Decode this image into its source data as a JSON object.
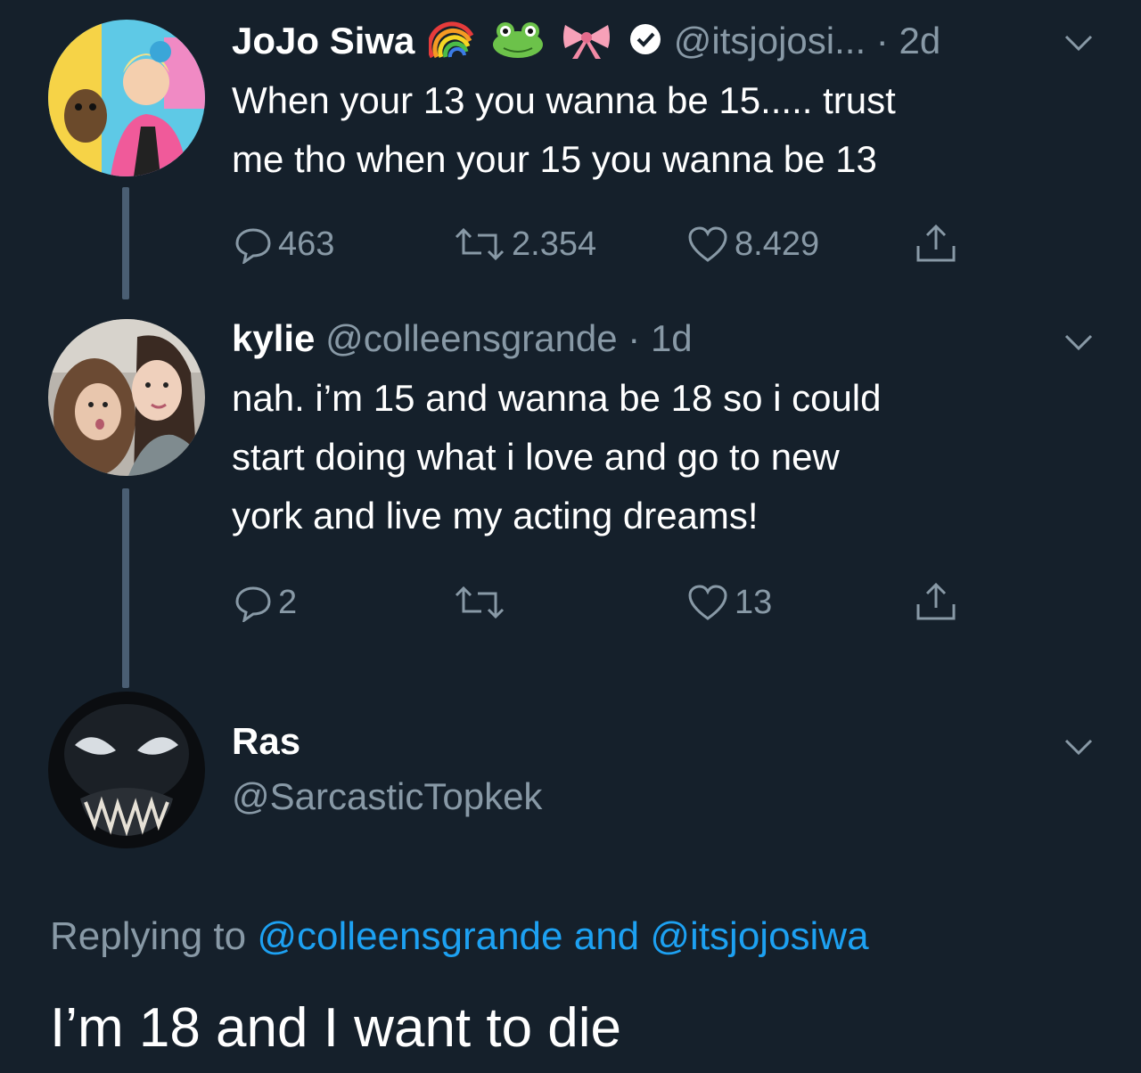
{
  "tweets": [
    {
      "name": "JoJo Siwa",
      "emojis": [
        "rainbow",
        "frog",
        "bow"
      ],
      "verified": true,
      "handle": "@itsjojosi...",
      "dot": "·",
      "time": "2d",
      "text": "When your 13 you wanna be 15..... trust\nme tho when your 15 you wanna be 13",
      "replies": "463",
      "retweets": "2.354",
      "likes": "8.429"
    },
    {
      "name": "kylie",
      "handle": "@colleensgrande",
      "dot": "·",
      "time": "1d",
      "text": "nah. i’m 15 and wanna be 18 so i could\nstart doing what i love and go to new\nyork and live my acting dreams!",
      "replies": "2",
      "retweets": "",
      "likes": "13"
    }
  ],
  "reply": {
    "name": "Ras",
    "handle": "@SarcasticTopkek",
    "replying_prefix": "Replying to",
    "mention1": "@colleensgrande",
    "and_word": "and",
    "mention2": "@itsjojosiwa",
    "text": "I’m 18 and I want to die"
  },
  "colors": {
    "background": "#15202b",
    "secondary_text": "#8899a6",
    "link": "#1da1f2",
    "thread_line": "#4a5e73"
  }
}
